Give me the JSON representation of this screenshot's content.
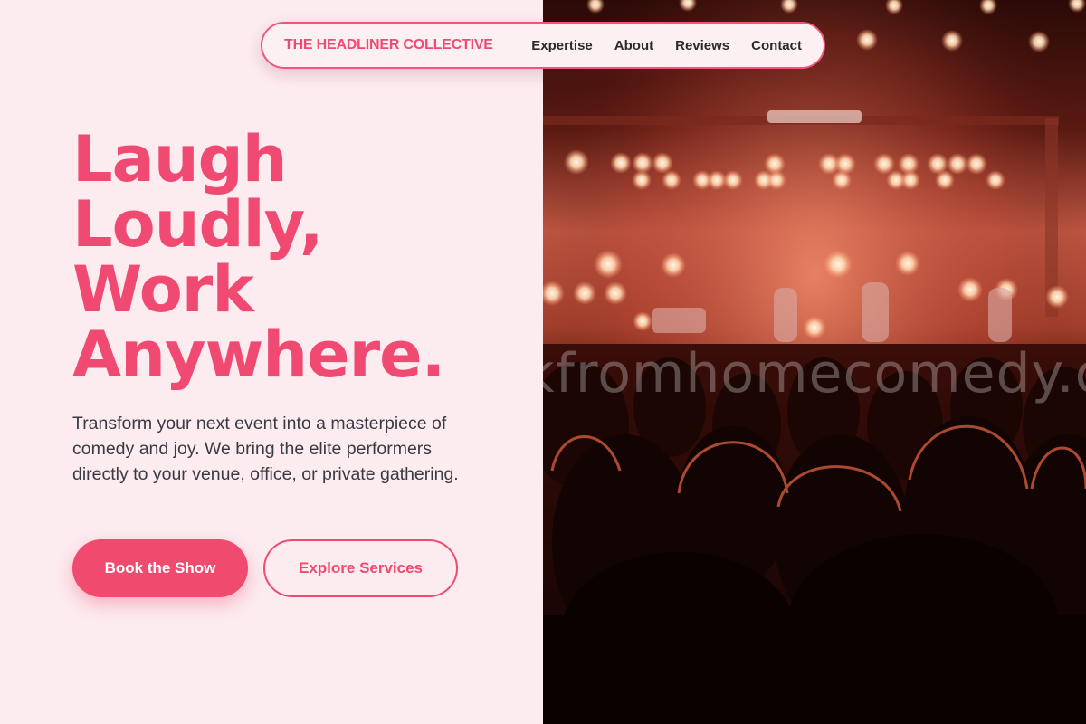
{
  "nav": {
    "brand": "THE HEADLINER COLLECTIVE",
    "links": [
      "Expertise",
      "About",
      "Reviews",
      "Contact"
    ]
  },
  "hero": {
    "headline_lines": [
      "Laugh",
      "Loudly,",
      "Work",
      "Anywhere."
    ],
    "subtext": "Transform your next event into a masterpiece of comedy and joy. We bring the elite performers directly to your venue, office, or private gathering.",
    "primary_cta": "Book the Show",
    "secondary_cta": "Explore Services",
    "image": {
      "description_icon": "concert-crowd-photo",
      "watermark": "kfromhomecomedy.c"
    }
  },
  "colors": {
    "accent": "#f04a6e",
    "panel_bg": "#fcebef",
    "text_dark": "#3a3a44"
  }
}
